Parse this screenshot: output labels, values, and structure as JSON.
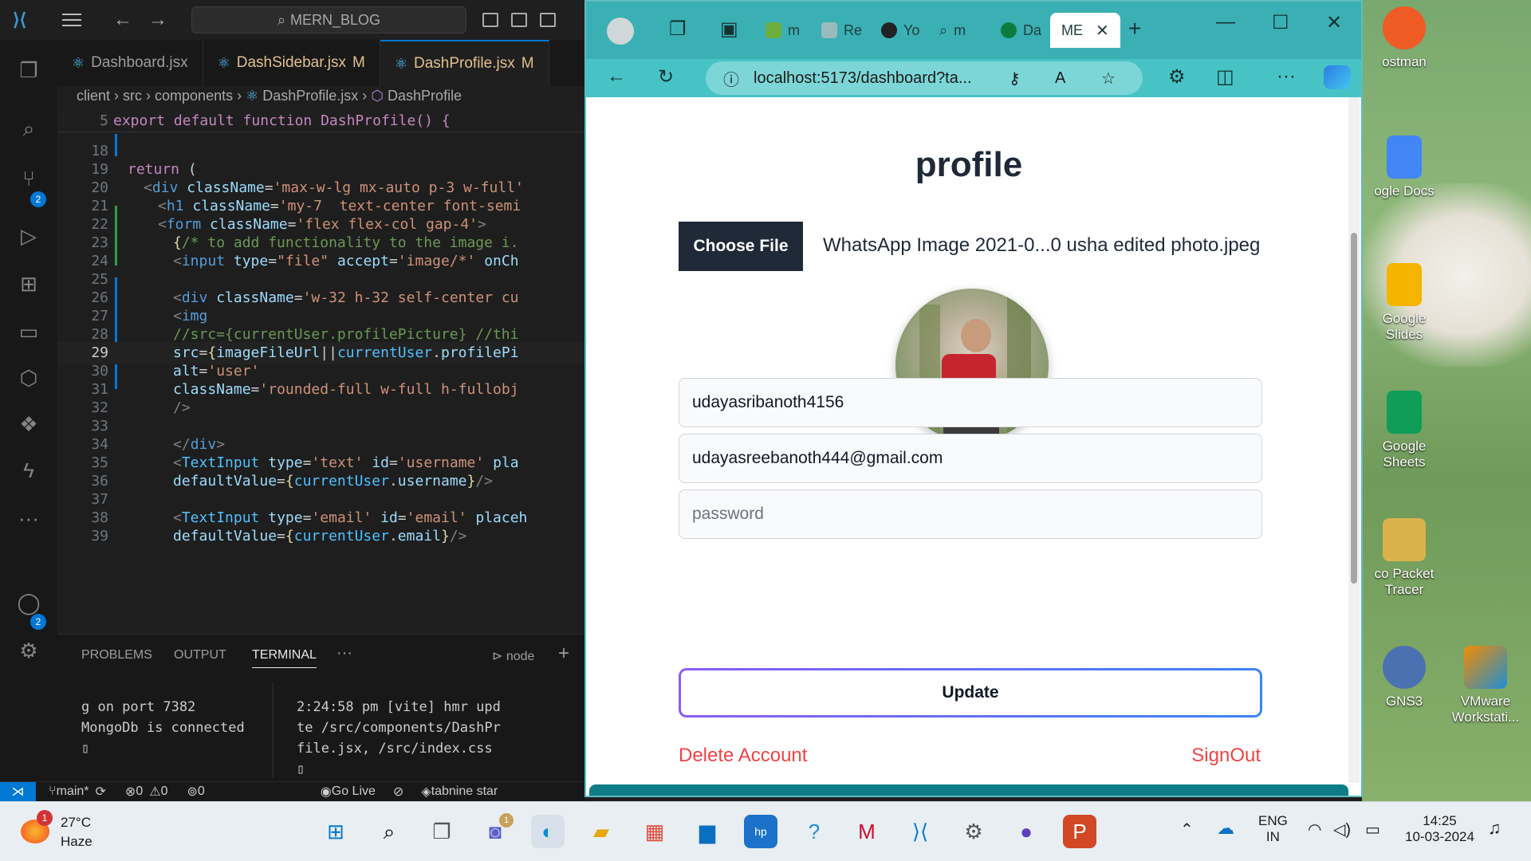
{
  "vscode": {
    "search_text": "MERN_BLOG",
    "tabs": [
      {
        "name": "Dashboard.jsx",
        "mod": ""
      },
      {
        "name": "DashSidebar.jsx",
        "mod": "M"
      },
      {
        "name": "DashProfile.jsx",
        "mod": "M"
      }
    ],
    "breadcrumb": {
      "p1": "client",
      "p2": "src",
      "p3": "components",
      "file": "DashProfile.jsx",
      "symbol": "DashProfile"
    },
    "sticky": {
      "num": "5",
      "text": "export default function DashProfile() {"
    },
    "activity_badges": {
      "scm": "2",
      "accounts": "2"
    },
    "panel": {
      "tabs": [
        "PROBLEMS",
        "OUTPUT",
        "TERMINAL"
      ],
      "more": "···",
      "terminal_name": "node",
      "left_lines": [
        "g on port 7382",
        "MongoDb is connected"
      ],
      "right_lines": [
        "2:24:58 pm [vite] hmr upd",
        "te /src/components/DashPr",
        "file.jsx, /src/index.css"
      ]
    },
    "status": {
      "branch": "main*",
      "errors": "0",
      "warnings": "0",
      "ports": "0",
      "golive": "Go Live",
      "tabnine": "tabnine star"
    }
  },
  "browser": {
    "tabs": [
      "m",
      "Re",
      "Yo",
      "m",
      "Da",
      "ME"
    ],
    "url": "localhost:5173/dashboard?ta...",
    "page": {
      "title": "profile",
      "choose_file": "Choose File",
      "file_name": "WhatsApp Image 2021-0...0 usha edited photo.jpeg",
      "username": "udayasribanoth4156",
      "email": "udayasreebanoth444@gmail.com",
      "password_placeholder": "password",
      "update": "Update",
      "delete": "Delete Account",
      "signout": "SignOut"
    }
  },
  "desktop": {
    "icons": [
      {
        "line1": "ostman",
        "line2": ""
      },
      {
        "line1": "ogle Docs",
        "line2": ""
      },
      {
        "line1": "Google",
        "line2": "Slides"
      },
      {
        "line1": "Google",
        "line2": "Sheets"
      },
      {
        "line1": "co Packet",
        "line2": "Tracer"
      },
      {
        "line1": "GNS3",
        "line2": ""
      },
      {
        "line1": "VMware",
        "line2": "Workstati..."
      }
    ]
  },
  "taskbar": {
    "weather_temp": "27°C",
    "weather_desc": "Haze",
    "weather_badge": "1",
    "teams_badge": "1",
    "lang1": "ENG",
    "lang2": "IN",
    "time": "14:25",
    "date": "10-03-2024"
  },
  "colors": {
    "accent": "#0078d4",
    "browser_frame": "#3ab0b4",
    "danger": "#ef4444",
    "button_dark": "#1f2937"
  }
}
